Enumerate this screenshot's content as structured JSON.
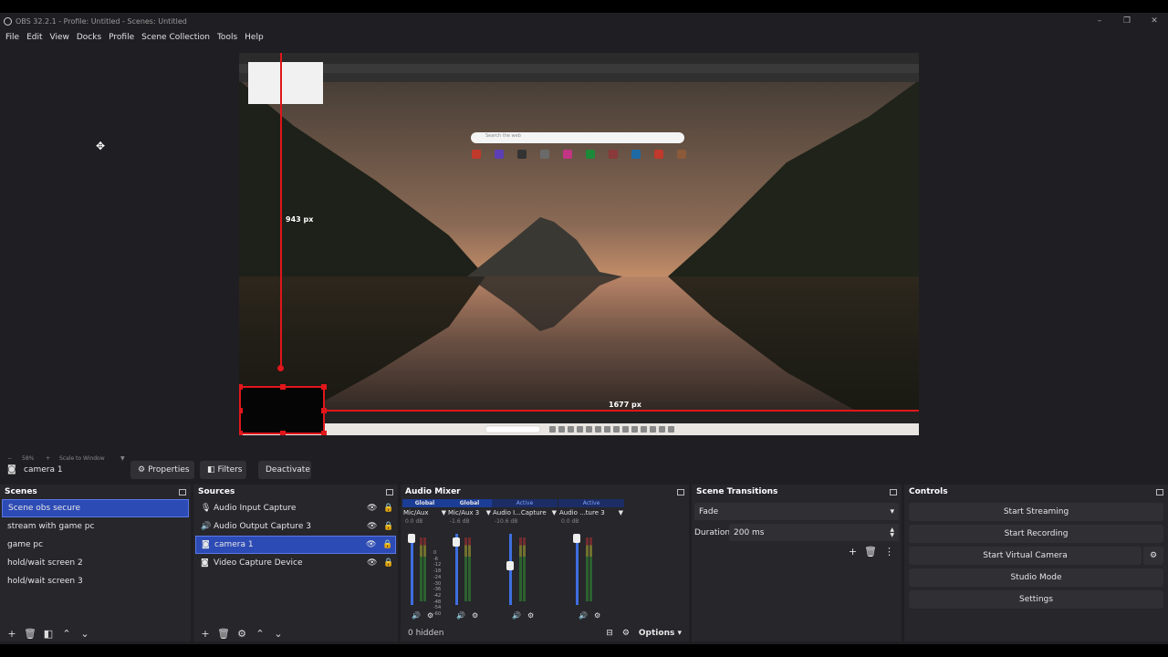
{
  "window": {
    "title": "OBS 32.2.1 - Profile: Untitled - Scenes: Untitled",
    "controls": [
      "–",
      "❐",
      "✕"
    ]
  },
  "menu": [
    "File",
    "Edit",
    "View",
    "Docks",
    "Profile",
    "Scene Collection",
    "Tools",
    "Help"
  ],
  "preview": {
    "height_label": "943 px",
    "width_label": "1677 px",
    "search_placeholder": "Search the web"
  },
  "zoom": {
    "percent": "58%",
    "mode": "Scale to Window"
  },
  "source_toolbar": {
    "selected_source": "camera 1",
    "properties": "Properties",
    "filters": "Filters",
    "deactivate": "Deactivate"
  },
  "scenes": {
    "title": "Scenes",
    "items": [
      "Scene obs secure",
      "stream with game pc",
      "game pc",
      "hold/wait screen 2",
      "hold/wait screen 3"
    ],
    "selected_index": 0
  },
  "sources": {
    "title": "Sources",
    "items": [
      {
        "name": "Audio Input Capture",
        "icon": "microphone-icon"
      },
      {
        "name": "Audio Output Capture 3",
        "icon": "speaker-icon"
      },
      {
        "name": "camera 1",
        "icon": "camera-icon"
      },
      {
        "name": "Video Capture Device",
        "icon": "camera-icon"
      }
    ],
    "selected_index": 2
  },
  "mixer": {
    "title": "Audio Mixer",
    "channels": [
      {
        "badge": "Global",
        "name": "Mic/Aux",
        "db": "0.0 dB"
      },
      {
        "badge": "Global",
        "name": "Mic/Aux 3",
        "db": "-1.6 dB"
      },
      {
        "badge": "Active",
        "name": "Audio I...Capture",
        "db": "-10.6 dB"
      },
      {
        "badge": "Active",
        "name": "Audio ...ture 3",
        "db": "0.0 dB"
      }
    ],
    "scale": [
      "0",
      "-6",
      "-12",
      "-18",
      "-24",
      "-30",
      "-36",
      "-42",
      "-48",
      "-54",
      "-60"
    ],
    "hidden": "0 hidden",
    "options": "Options"
  },
  "transitions": {
    "title": "Scene Transitions",
    "selected": "Fade",
    "duration_label": "Duration",
    "duration_value": "200 ms"
  },
  "controls": {
    "title": "Controls",
    "buttons": [
      "Start Streaming",
      "Start Recording",
      "Start Virtual Camera",
      "Studio Mode",
      "Settings"
    ]
  },
  "colors": {
    "accent": "#2d4bb5",
    "guide": "#e0161b",
    "badge": "#1c3d96"
  }
}
